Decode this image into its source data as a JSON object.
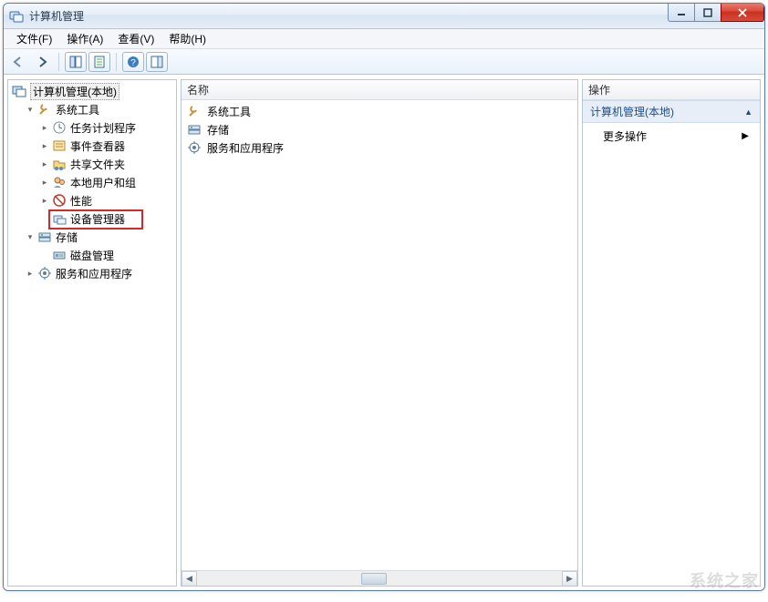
{
  "window": {
    "title": "计算机管理"
  },
  "menu": {
    "file": "文件(F)",
    "action": "操作(A)",
    "view": "查看(V)",
    "help": "帮助(H)"
  },
  "left_pane": {
    "root": "计算机管理(本地)",
    "sys_tools": "系统工具",
    "task_scheduler": "任务计划程序",
    "event_viewer": "事件查看器",
    "shared_folders": "共享文件夹",
    "local_users": "本地用户和组",
    "performance": "性能",
    "device_manager": "设备管理器",
    "storage": "存储",
    "disk_mgmt": "磁盘管理",
    "services_apps": "服务和应用程序"
  },
  "center": {
    "header": "名称",
    "items": {
      "sys_tools": "系统工具",
      "storage": "存储",
      "services_apps": "服务和应用程序"
    }
  },
  "actions": {
    "header": "操作",
    "subhead": "计算机管理(本地)",
    "more": "更多操作"
  },
  "watermark": "系统之家"
}
